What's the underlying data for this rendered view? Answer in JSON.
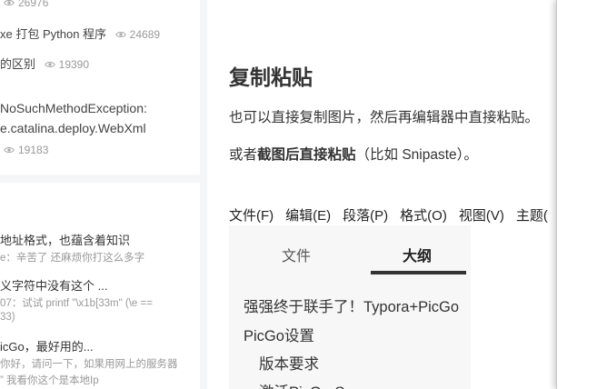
{
  "sidebar": {
    "popular": [
      {
        "title": "",
        "views": "26976"
      },
      {
        "title": "xe 打包 Python 程序",
        "views": "24689"
      },
      {
        "title": "的区别",
        "views": "19390"
      },
      {
        "title": "NoSuchMethodException:",
        "title2": "e.catalina.deploy.WebXml",
        "views": "19183"
      }
    ],
    "comments": [
      {
        "title": "地址格式，也蕴含着知识",
        "sub": "e：辛苦了 还麻烦你打这么多字"
      },
      {
        "title": "义字符中没有这个 ...",
        "sub": "07：试试 printf \"\\x1b[33m\" (\\e ==",
        "sub2": "33)"
      },
      {
        "title": "icGo，最好用的...",
        "sub": "你好，请问一下，如果用网上的服务器",
        "sub2": "” 我看你这个是本地Ip"
      }
    ]
  },
  "article": {
    "heading": "复制粘贴",
    "para1": "也可以直接复制图片，然后再编辑器中直接粘贴。",
    "para2_prefix": "或者",
    "para2_bold": "截图后直接粘贴",
    "para2_suffix": "（比如 Snipaste）。",
    "menubar": [
      "文件(F)",
      "编辑(E)",
      "段落(P)",
      "格式(O)",
      "视图(V)",
      "主题("
    ],
    "tabs": {
      "files": "文件",
      "outline": "大纲"
    },
    "outline_items": [
      "强强终于联手了！Typora+PicGo",
      "PicGo设置",
      "版本要求",
      "激活PicGo-Server"
    ]
  }
}
